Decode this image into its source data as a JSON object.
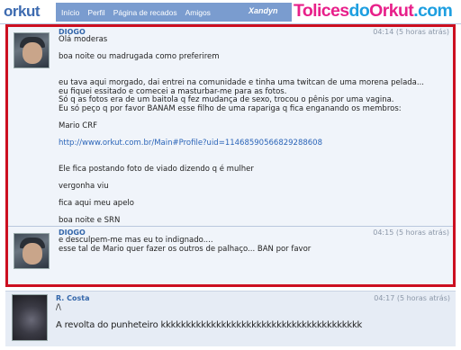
{
  "header": {
    "logo": "orkut",
    "nav": [
      "Início",
      "Perfil",
      "Página de recados",
      "Amigos"
    ],
    "user": "Xandyn",
    "watermark_part1": "Tolices",
    "watermark_part2": "do",
    "watermark_part3": "Orkut",
    "watermark_part4": ".com"
  },
  "posts": [
    {
      "author": "DIOGO",
      "time": "04:14 (5 horas atrás)",
      "lines": [
        "Olá moderas",
        "",
        "boa noite ou madrugada como preferirem",
        "",
        "",
        "eu tava aqui morgado, dai entrei na comunidade e tinha uma twitcan de uma morena pelada...",
        "eu fiquei essitado e comecei a masturbar-me para as fotos.",
        "Só q as fotos era de um baitola q fez mudança de sexo, trocou o pênis por uma vagina.",
        "Eu só peço q por favor BANAM esse filho de uma rapariga q fica enganando os membros:",
        "",
        "Mario CRF",
        "",
        "http://www.orkut.com.br/Main#Profile?uid=11468590566829288608",
        "",
        "",
        "Ele fica postando foto de viado dizendo q é mulher",
        "",
        "vergonha viu",
        "",
        "fica aqui meu apelo",
        "",
        "boa noite e SRN"
      ]
    },
    {
      "author": "DIOGO",
      "time": "04:15 (5 horas atrás)",
      "lines": [
        "e desculpem-me mas eu to indignado....",
        "esse tal de Mario quer fazer os outros de palhaço... BAN por favor"
      ]
    },
    {
      "author": "R. Costa",
      "time": "04:17 (5 horas atrás)",
      "lines": [
        "/\\",
        "",
        "A revolta do punheteiro kkkkkkkkkkkkkkkkkkkkkkkkkkkkkkkkkkkkkkkk"
      ]
    }
  ],
  "colors": {
    "highlight_border": "#cc0f20",
    "link": "#2a64b8",
    "author": "#3366aa",
    "nav_bg": "#7a9ccf"
  }
}
